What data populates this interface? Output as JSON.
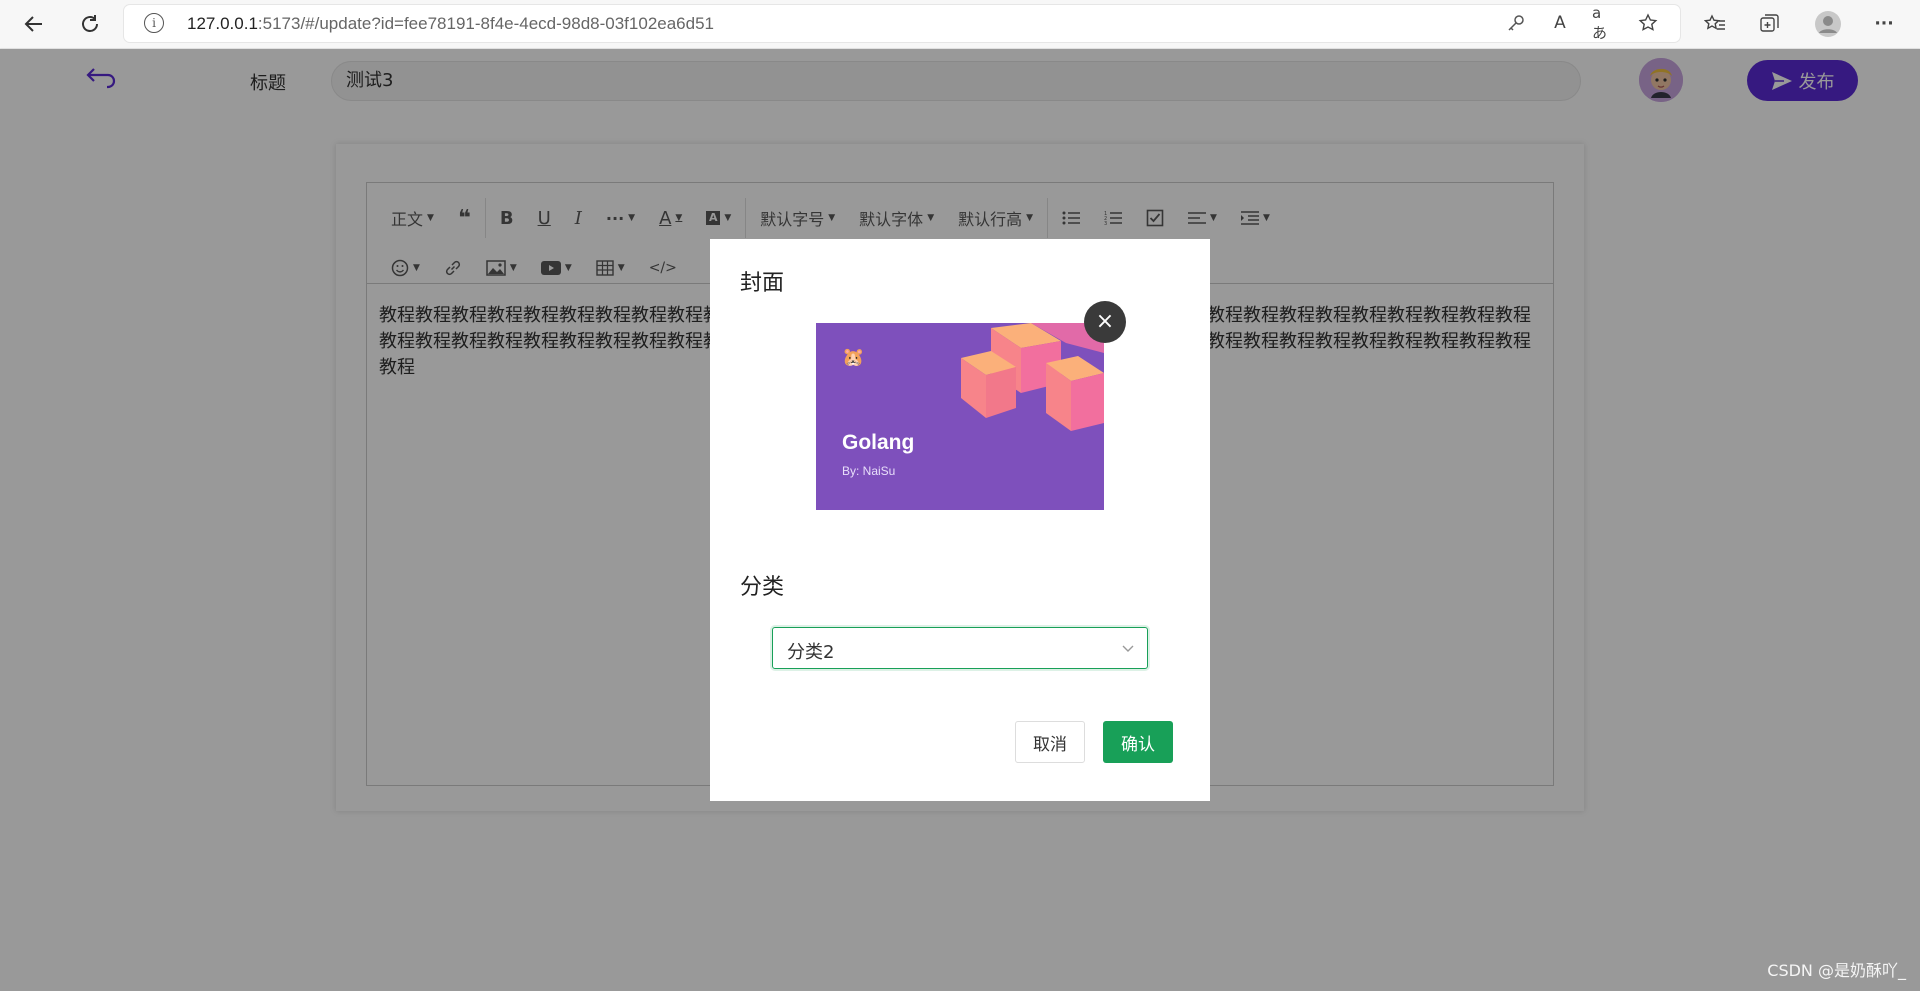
{
  "browser": {
    "url_host": "127.0.0.1",
    "url_path": ":5173/#/update?id=fee78191-8f4e-4ecd-98d8-03f102ea6d51",
    "read_aloud_glyph": "A",
    "translate_glyph": "aあ"
  },
  "header": {
    "title_label": "标题",
    "title_value": "测试3",
    "publish_label": "发布"
  },
  "toolbar": {
    "row1": [
      {
        "label": "正文",
        "icon": "paragraph-style",
        "has_caret": true
      },
      {
        "label": "",
        "icon": "blockquote-icon",
        "has_caret": false
      },
      {
        "label": "",
        "icon": "bold-icon",
        "has_caret": false
      },
      {
        "label": "",
        "icon": "underline-icon",
        "has_caret": false
      },
      {
        "label": "",
        "icon": "italic-icon",
        "has_caret": false
      },
      {
        "label": "",
        "icon": "more-icon",
        "has_caret": true
      },
      {
        "label": "",
        "icon": "font-color-icon",
        "has_caret": true
      },
      {
        "label": "",
        "icon": "bg-color-icon",
        "has_caret": true
      },
      {
        "label": "默认字号",
        "icon": "font-size",
        "has_caret": true
      },
      {
        "label": "默认字体",
        "icon": "font-family",
        "has_caret": true
      },
      {
        "label": "默认行高",
        "icon": "line-height",
        "has_caret": true
      },
      {
        "label": "",
        "icon": "bulleted-list-icon",
        "has_caret": false
      },
      {
        "label": "",
        "icon": "numbered-list-icon",
        "has_caret": false
      },
      {
        "label": "",
        "icon": "todo-icon",
        "has_caret": false
      },
      {
        "label": "",
        "icon": "align-icon",
        "has_caret": true
      },
      {
        "label": "",
        "icon": "indent-icon",
        "has_caret": true
      }
    ],
    "row2": [
      {
        "label": "",
        "icon": "emoji-icon",
        "has_caret": true
      },
      {
        "label": "",
        "icon": "link-icon",
        "has_caret": false
      },
      {
        "label": "",
        "icon": "image-icon",
        "has_caret": true
      },
      {
        "label": "",
        "icon": "video-icon",
        "has_caret": true
      },
      {
        "label": "",
        "icon": "table-icon",
        "has_caret": true
      },
      {
        "label": "",
        "icon": "code-icon",
        "has_caret": false
      }
    ]
  },
  "editor": {
    "content": "教程教程教程教程教程教程教程教程教程教程教程教程教程教程教程教程教程教程教程教程教程教程教程教程教程教程教程教程教程教程教程教程教程教程教程教程教程教程教程教程教程教程教程教程教程教程教程教程教程教程教程教程教程教程教程教程教程教程教程教程教程教程教程教程教程"
  },
  "dialog": {
    "cover_title": "封面",
    "cover_image": {
      "title": "Golang",
      "subtitle": "By: NaiSu",
      "bg_color": "#7e50bc"
    },
    "close_glyph": "×",
    "category_title": "分类",
    "category_value": "分类2",
    "cancel_label": "取消",
    "confirm_label": "确认"
  },
  "colors": {
    "brand_purple": "#5b2bd6",
    "confirm_green": "#18a058"
  },
  "watermark": "CSDN @是奶酥吖_"
}
